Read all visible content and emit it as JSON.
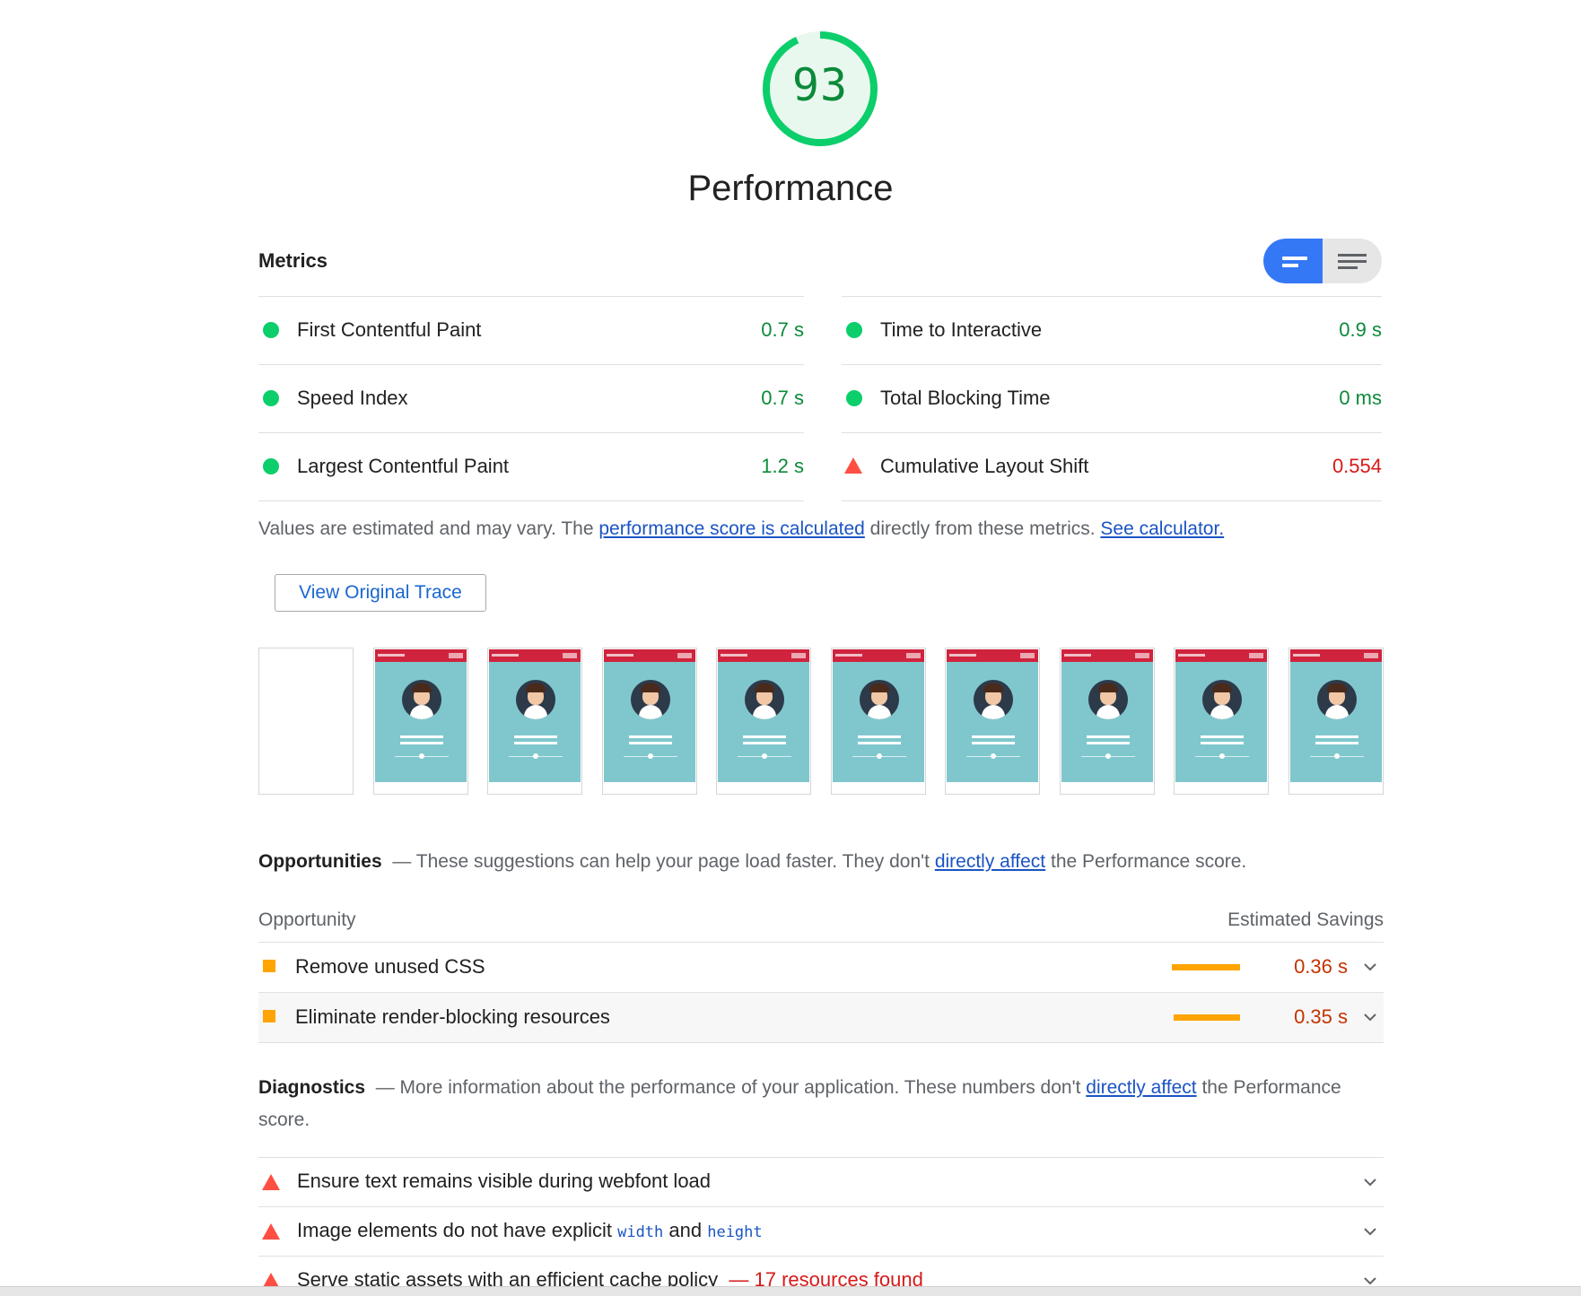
{
  "score": {
    "value": "93",
    "fraction": 0.93,
    "color": "#0cce6b"
  },
  "category_title": "Performance",
  "metrics": {
    "heading": "Metrics",
    "left": [
      {
        "label": "First Contentful Paint",
        "value": "0.7 s",
        "status": "pass"
      },
      {
        "label": "Speed Index",
        "value": "0.7 s",
        "status": "pass"
      },
      {
        "label": "Largest Contentful Paint",
        "value": "1.2 s",
        "status": "pass"
      }
    ],
    "right": [
      {
        "label": "Time to Interactive",
        "value": "0.9 s",
        "status": "pass"
      },
      {
        "label": "Total Blocking Time",
        "value": "0 ms",
        "status": "pass"
      },
      {
        "label": "Cumulative Layout Shift",
        "value": "0.554",
        "status": "fail"
      }
    ],
    "view_toggle": {
      "selected": "compact-view",
      "icons": [
        "compact-view-icon",
        "expanded-view-icon"
      ]
    }
  },
  "estimate_note": {
    "prefix": "Values are estimated and may vary. The ",
    "link1": "performance score is calculated",
    "middle": " directly from these metrics. ",
    "link2": "See calculator."
  },
  "trace_button": "View Original Trace",
  "filmstrip": {
    "frame_count": 10,
    "blank_frames": 1
  },
  "opportunities": {
    "title": "Opportunities",
    "dash": "—",
    "desc_prefix": " These suggestions can help your page load faster. They don't ",
    "link": "directly affect",
    "desc_suffix": " the Performance score.",
    "col_left": "Opportunity",
    "col_right": "Estimated Savings",
    "items": [
      {
        "label": "Remove unused CSS",
        "savings": "0.36 s",
        "fraction": 1.0
      },
      {
        "label": "Eliminate render-blocking resources",
        "savings": "0.35 s",
        "fraction": 0.97
      }
    ]
  },
  "diagnostics": {
    "title": "Diagnostics",
    "dash": "—",
    "desc_prefix": " More information about the performance of your application. These numbers don't ",
    "link": "directly affect",
    "desc_suffix": " the Performance score.",
    "items": [
      {
        "label": "Ensure text remains visible during webfont load"
      },
      {
        "pre": "Image elements do not have explicit ",
        "code1": "width",
        "mid": " and ",
        "code2": "height"
      },
      {
        "label": "Serve static assets with an efficient cache policy",
        "dash": "—",
        "extra": "17 resources found"
      }
    ]
  },
  "colors": {
    "pass": "#0cce6b",
    "average": "#ffa400",
    "fail": "#ff4e42",
    "accent": "#3478f6"
  }
}
